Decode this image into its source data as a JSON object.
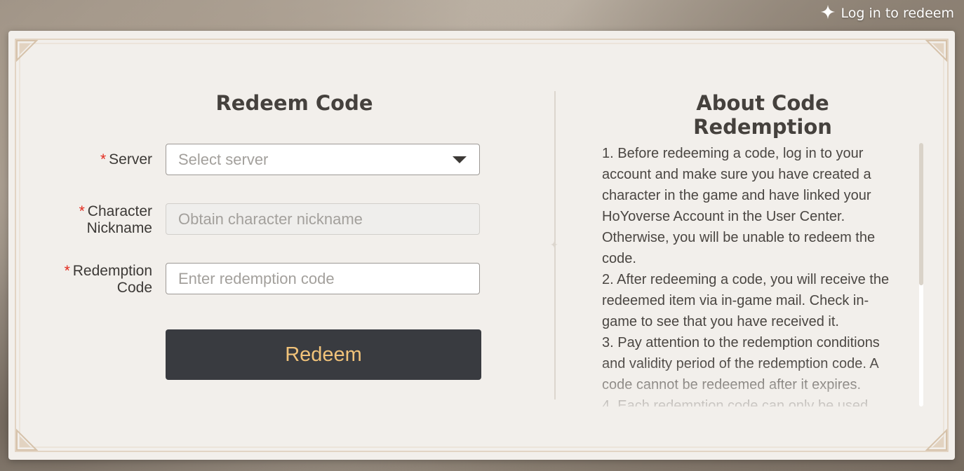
{
  "header": {
    "login_label": "Log in to redeem",
    "login_icon": "sparkle-icon"
  },
  "form": {
    "title": "Redeem Code",
    "required_mark": "*",
    "server": {
      "label": "Server",
      "placeholder": "Select server"
    },
    "nickname": {
      "label_line1": "Character",
      "label_line2": "Nickname",
      "placeholder": "Obtain character nickname"
    },
    "code": {
      "label_line1": "Redemption",
      "label_line2": "Code",
      "placeholder": "Enter redemption code"
    },
    "submit_label": "Redeem"
  },
  "info": {
    "title": "About Code Redemption",
    "items": [
      "1. Before redeeming a code, log in to your account and make sure you have created a character in the game and have linked your HoYoverse Account in the User Center. Otherwise, you will be unable to redeem the code.",
      "2. After redeeming a code, you will receive the redeemed item via in-game mail. Check in-game to see that you have received it.",
      "3. Pay attention to the redemption conditions and validity period of the redemption code. A code cannot be redeemed after it expires.",
      "4. Each redemption code can only be used"
    ]
  },
  "colors": {
    "button_bg": "#393b40",
    "button_text": "#f1c37a",
    "required": "#e2291c",
    "card_bg": "#f2efeb"
  }
}
